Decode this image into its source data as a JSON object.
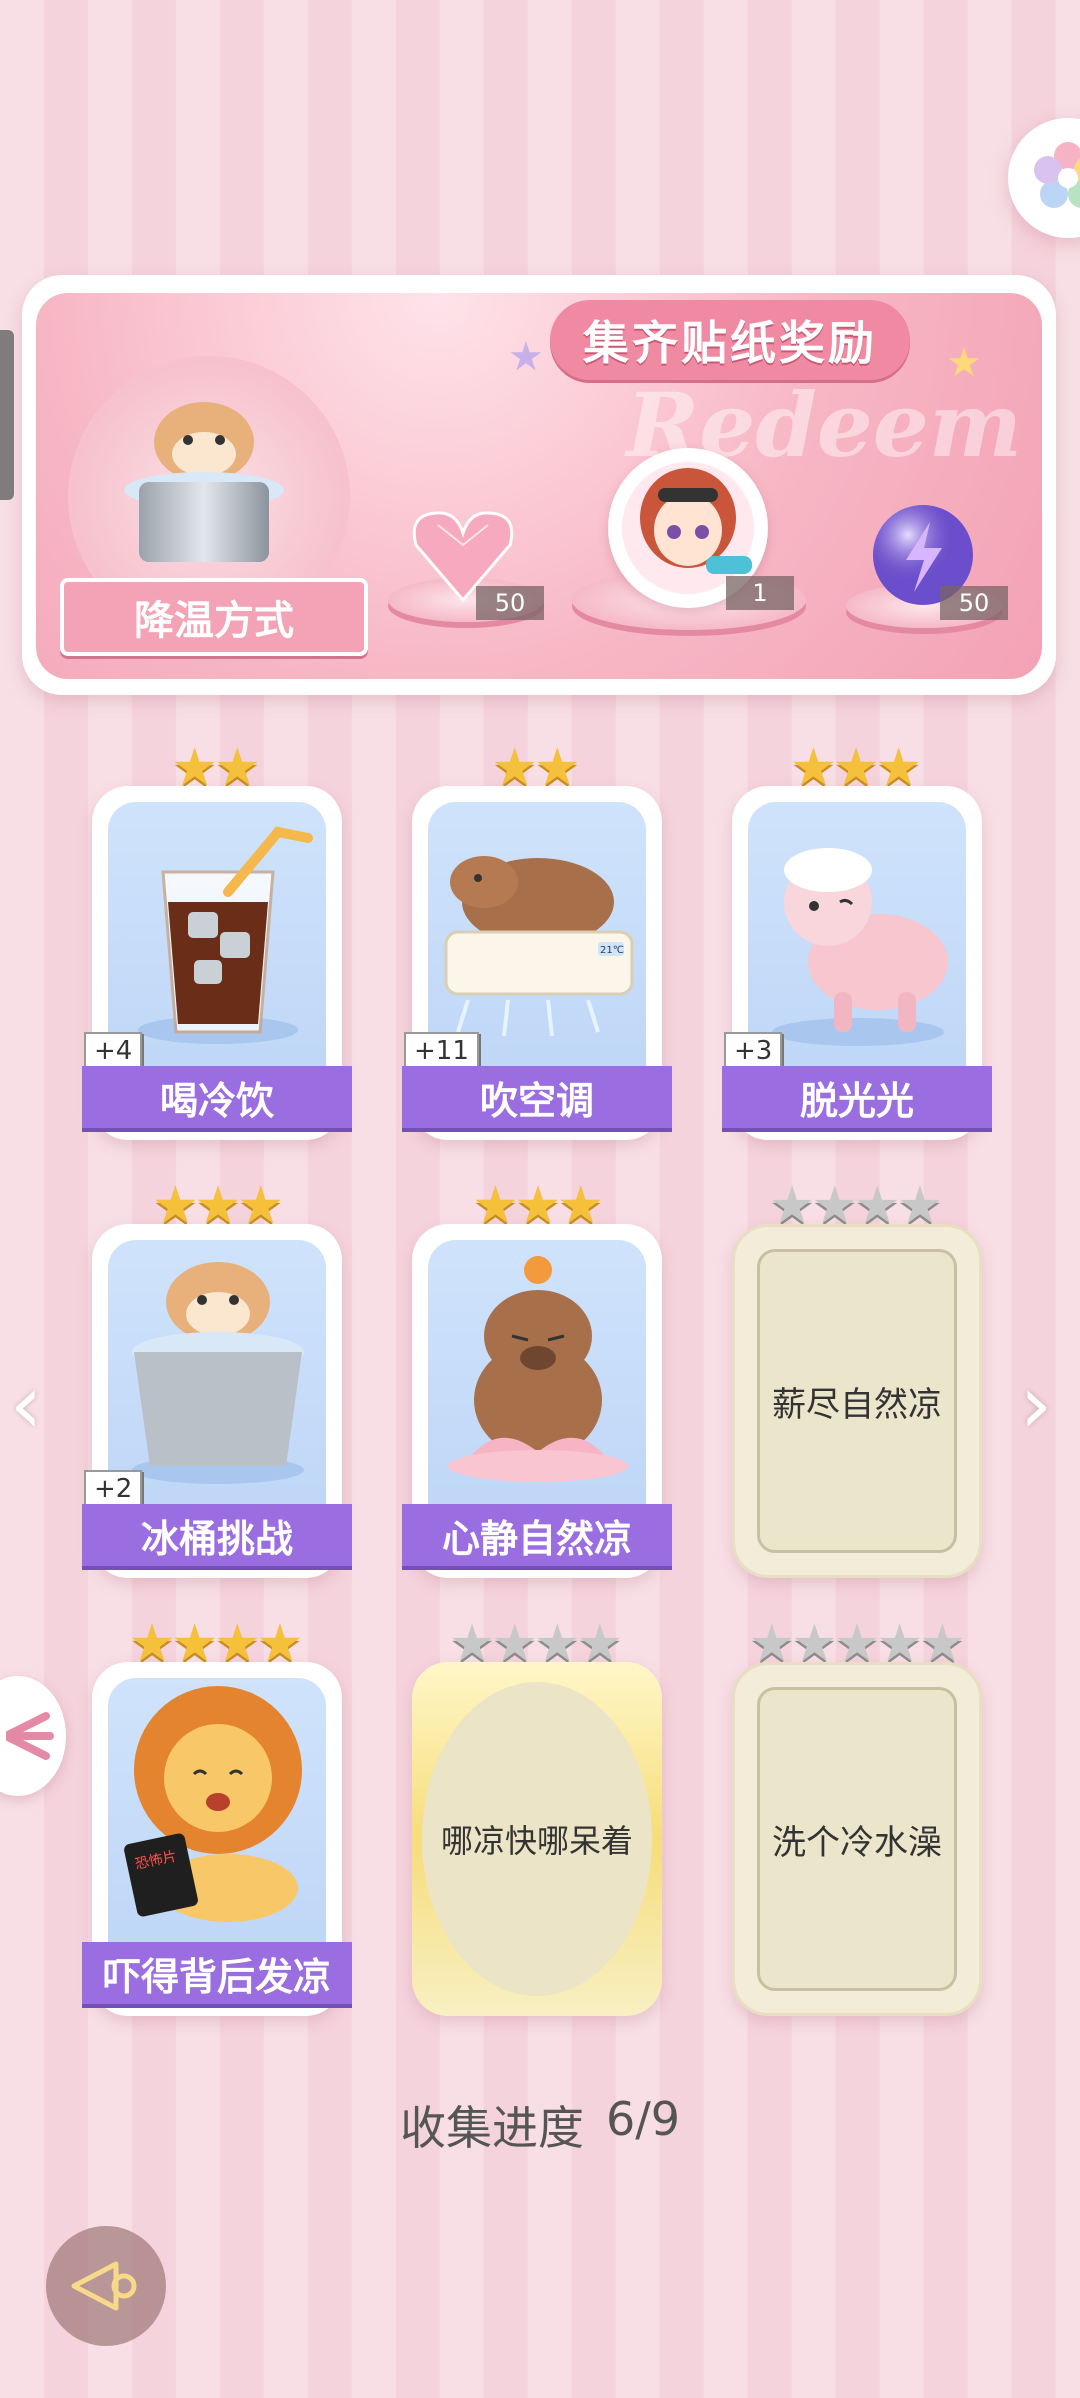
{
  "banner": {
    "title": "集齐贴纸奖励",
    "watermark": "Redeem",
    "method_label": "降温方式",
    "rewards": [
      {
        "icon": "pink-heart-gem-icon",
        "count": "50"
      },
      {
        "icon": "avatar-girl-water-gun-icon",
        "count": "1"
      },
      {
        "icon": "purple-lightning-orb-icon",
        "count": "50"
      }
    ]
  },
  "cards": [
    {
      "label": "喝冷饮",
      "stars": 2,
      "unlocked": true,
      "bonus": "+4",
      "art": "iced-drink-icon"
    },
    {
      "label": "吹空调",
      "stars": 2,
      "unlocked": true,
      "bonus": "+11",
      "art": "capybara-air-conditioner-icon"
    },
    {
      "label": "脱光光",
      "stars": 3,
      "unlocked": true,
      "bonus": "+3",
      "art": "pink-sheep-icon"
    },
    {
      "label": "冰桶挑战",
      "stars": 3,
      "unlocked": true,
      "bonus": "+2",
      "art": "hamster-ice-bucket-icon"
    },
    {
      "label": "心静自然凉",
      "stars": 3,
      "unlocked": true,
      "bonus": "",
      "art": "meditating-capybara-icon"
    },
    {
      "label": "薪尽自然凉",
      "stars": 4,
      "unlocked": false,
      "bonus": "",
      "art": ""
    },
    {
      "label": "吓得背后发凉",
      "stars": 4,
      "unlocked": true,
      "bonus": "",
      "art": "scared-lion-icon"
    },
    {
      "label": "哪凉快哪呆着",
      "stars": 4,
      "unlocked": false,
      "bonus": "",
      "art": ""
    },
    {
      "label": "洗个冷水澡",
      "stars": 5,
      "unlocked": false,
      "bonus": "",
      "art": ""
    }
  ],
  "horror_dvd_text": "恐怖片",
  "ac_temp": "21℃",
  "progress": {
    "label": "收集进度",
    "value": "6/9"
  },
  "colors": {
    "ribbon": "#9a6ee0",
    "star_gold": "#f6c13a",
    "star_grey": "#c8c8c8",
    "banner_pink": "#f3a2b5"
  }
}
